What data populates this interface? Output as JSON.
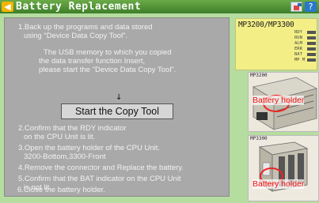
{
  "window": {
    "title": "Battery Replacement",
    "back_icon": "arrow-left-icon",
    "toolbar_icons": [
      "panel-view-icon",
      "help-icon"
    ],
    "colors": {
      "titlebar": "#4f8f35",
      "background": "#b5dd9f",
      "panel": "#a9a9a9",
      "accent": "#f4b400",
      "label_red": "#e11111"
    }
  },
  "instructions": {
    "step1_line1": "1.Back up the programs and data stored",
    "step1_line2": "using \"Device Data Copy Tool\".",
    "note_line1": "The USB memory to which you copied",
    "note_line2": "the data transfer function Insert,",
    "note_line3": "please start the \"Device Data Copy Tool\".",
    "arrow": "↓",
    "copy_button": "Start the Copy Tool",
    "step2_line1": "2.Confirm that the RDY indicator",
    "step2_line2": "on the CPU Unit is lit.",
    "step3_line1": "3.Open the battery holder of the CPU Unit.",
    "step3_line2": "3200-Bottom,3300-Front",
    "step4": "4.Remove the connector and Replace the battery.",
    "step5_line1": "5.Confirm that the BAT indicator on the CPU Unit",
    "step5_line2": "is not lit.",
    "step6": "6.Close the battery holder."
  },
  "lcd": {
    "model": "MP3200/MP3300",
    "indicators": [
      "RDY",
      "RUN",
      "ALM",
      "ERR",
      "BAT",
      "MP M"
    ]
  },
  "photos": {
    "top_label": "MP3200",
    "top_holder": "Battery holder",
    "bottom_label": "MP3300",
    "bottom_holder": "Battery holder"
  }
}
